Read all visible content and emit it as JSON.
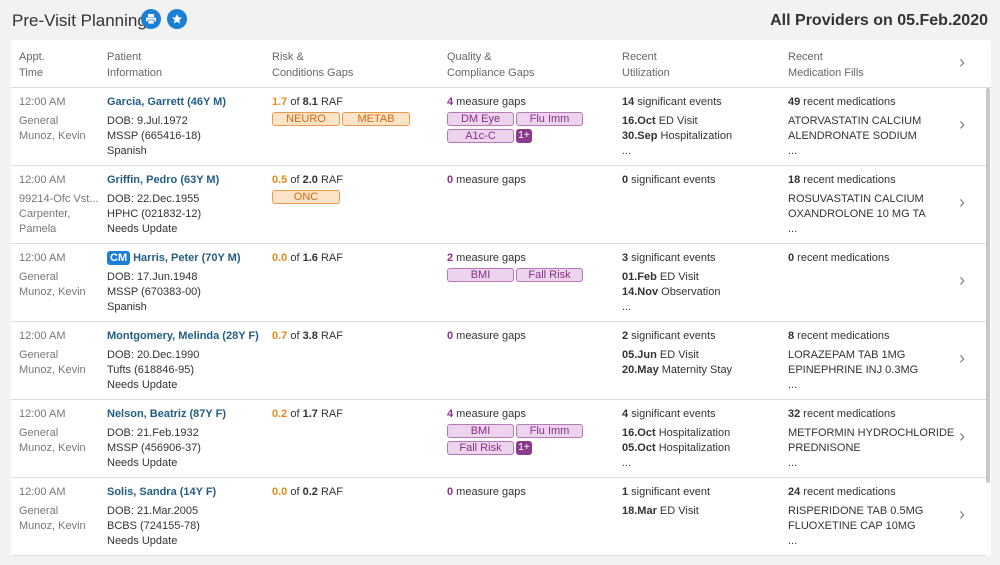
{
  "header": {
    "title": "Pre-Visit Planning",
    "print_icon": "print-icon",
    "star_icon": "star-icon",
    "right_title": "All Providers on 05.Feb.2020"
  },
  "columns": [
    {
      "line1": "Appt.",
      "line2": "Time"
    },
    {
      "line1": "Patient",
      "line2": "Information"
    },
    {
      "line1": "Risk &",
      "line2": "Conditions Gaps"
    },
    {
      "line1": "Quality &",
      "line2": "Compliance Gaps"
    },
    {
      "line1": "Recent",
      "line2": "Utilization"
    },
    {
      "line1": "Recent",
      "line2": "Medication Fills"
    }
  ],
  "rows": [
    {
      "time": "12:00 AM",
      "loc1": "General",
      "loc2": "Munoz, Kevin",
      "loc3": "",
      "cm": "",
      "name": "Garcia, Garrett (46Y M)",
      "dob": "DOB: 9.Jul.1972",
      "plan": "MSSP (665416-18)",
      "extra": "Spanish",
      "raf_val": "1.7",
      "raf_of": " of ",
      "raf_max": "8.1",
      "raf_label": " RAF",
      "risk_tags": [
        "NEURO",
        "METAB"
      ],
      "gap_count": "4",
      "gap_label": " measure gaps",
      "quality_tags": [
        [
          "DM Eye",
          "Flu Imm"
        ],
        [
          "A1c-C"
        ]
      ],
      "quality_more": "1+",
      "util_count": "14",
      "util_label": " significant events",
      "util_events": [
        [
          "16.Oct",
          " ED Visit"
        ],
        [
          "30.Sep",
          " Hospitalization"
        ]
      ],
      "util_more": "...",
      "med_count": "49",
      "med_label": " recent medications",
      "meds": [
        "ATORVASTATIN CALCIUM",
        "ALENDRONATE SODIUM"
      ],
      "med_more": "..."
    },
    {
      "time": "12:00 AM",
      "loc1": "99214-Ofc Vst...",
      "loc2": "Carpenter,",
      "loc3": "Pamela",
      "cm": "",
      "name": "Griffin, Pedro (63Y M)",
      "dob": "DOB: 22.Dec.1955",
      "plan": "HPHC (021832-12)",
      "extra": "Needs Update",
      "raf_val": "0.5",
      "raf_of": " of ",
      "raf_max": "2.0",
      "raf_label": " RAF",
      "risk_tags": [
        "ONC"
      ],
      "gap_count": "0",
      "gap_label": " measure gaps",
      "quality_tags": [],
      "quality_more": "",
      "util_count": "0",
      "util_label": " significant events",
      "util_events": [],
      "util_more": "",
      "med_count": "18",
      "med_label": " recent medications",
      "meds": [
        "ROSUVASTATIN CALCIUM",
        "OXANDROLONE 10 MG TA"
      ],
      "med_more": "..."
    },
    {
      "time": "12:00 AM",
      "loc1": "General",
      "loc2": "Munoz, Kevin",
      "loc3": "",
      "cm": "CM",
      "name": "Harris, Peter (70Y M)",
      "dob": "DOB: 17.Jun.1948",
      "plan": "MSSP (670383-00)",
      "extra": "Spanish",
      "raf_val": "0.0",
      "raf_of": " of ",
      "raf_max": "1.6",
      "raf_label": " RAF",
      "risk_tags": [],
      "gap_count": "2",
      "gap_label": " measure gaps",
      "quality_tags": [
        [
          "BMI",
          "Fall Risk"
        ]
      ],
      "quality_more": "",
      "util_count": "3",
      "util_label": " significant events",
      "util_events": [
        [
          "01.Feb",
          " ED Visit"
        ],
        [
          "14.Nov",
          " Observation"
        ]
      ],
      "util_more": "...",
      "med_count": "0",
      "med_label": " recent medications",
      "meds": [],
      "med_more": ""
    },
    {
      "time": "12:00 AM",
      "loc1": "General",
      "loc2": "Munoz, Kevin",
      "loc3": "",
      "cm": "",
      "name": "Montgomery, Melinda (28Y F)",
      "dob": "DOB: 20.Dec.1990",
      "plan": "Tufts (618846-95)",
      "extra": "Needs Update",
      "raf_val": "0.7",
      "raf_of": " of ",
      "raf_max": "3.8",
      "raf_label": " RAF",
      "risk_tags": [],
      "gap_count": "0",
      "gap_label": " measure gaps",
      "quality_tags": [],
      "quality_more": "",
      "util_count": "2",
      "util_label": " significant events",
      "util_events": [
        [
          "05.Jun",
          " ED Visit"
        ],
        [
          "20.May",
          " Maternity Stay"
        ]
      ],
      "util_more": "",
      "med_count": "8",
      "med_label": " recent medications",
      "meds": [
        "LORAZEPAM TAB 1MG",
        "EPINEPHRINE INJ 0.3MG"
      ],
      "med_more": "..."
    },
    {
      "time": "12:00 AM",
      "loc1": "General",
      "loc2": "Munoz, Kevin",
      "loc3": "",
      "cm": "",
      "name": "Nelson, Beatriz (87Y F)",
      "dob": "DOB: 21.Feb.1932",
      "plan": "MSSP (456906-37)",
      "extra": "Needs Update",
      "raf_val": "0.2",
      "raf_of": " of ",
      "raf_max": "1.7",
      "raf_label": " RAF",
      "risk_tags": [],
      "gap_count": "4",
      "gap_label": " measure gaps",
      "quality_tags": [
        [
          "BMI",
          "Flu Imm"
        ],
        [
          "Fall Risk"
        ]
      ],
      "quality_more": "1+",
      "util_count": "4",
      "util_label": " significant events",
      "util_events": [
        [
          "16.Oct",
          " Hospitalization"
        ],
        [
          "05.Oct",
          " Hospitalization"
        ]
      ],
      "util_more": "...",
      "med_count": "32",
      "med_label": " recent medications",
      "meds": [
        "METFORMIN HYDROCHLORIDE",
        "PREDNISONE"
      ],
      "med_more": "..."
    },
    {
      "time": "12:00 AM",
      "loc1": "General",
      "loc2": "Munoz, Kevin",
      "loc3": "",
      "cm": "",
      "name": "Solis, Sandra (14Y F)",
      "dob": "DOB: 21.Mar.2005",
      "plan": "BCBS (724155-78)",
      "extra": "Needs Update",
      "raf_val": "0.0",
      "raf_of": " of ",
      "raf_max": "0.2",
      "raf_label": " RAF",
      "risk_tags": [],
      "gap_count": "0",
      "gap_label": " measure gaps",
      "quality_tags": [],
      "quality_more": "",
      "util_count": "1",
      "util_label": " significant event",
      "util_events": [
        [
          "18.Mar",
          " ED Visit"
        ]
      ],
      "util_more": "",
      "med_count": "24",
      "med_label": " recent medications",
      "meds": [
        "RISPERIDONE TAB 0.5MG",
        "FLUOXETINE CAP 10MG"
      ],
      "med_more": "..."
    }
  ]
}
